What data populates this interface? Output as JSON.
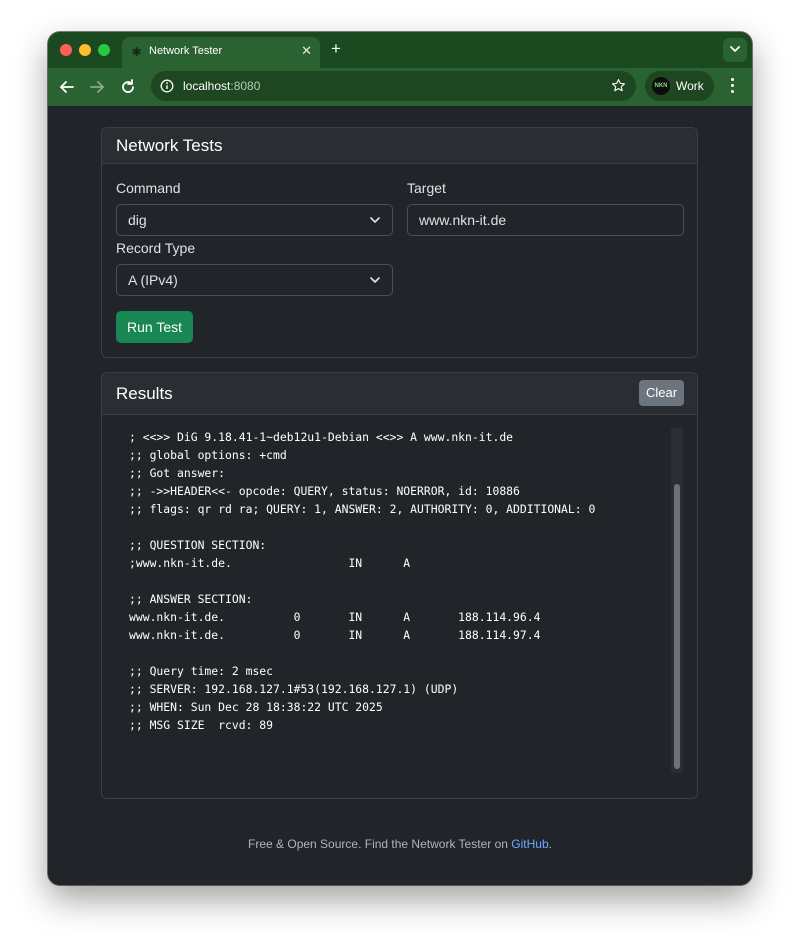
{
  "browser": {
    "tab_title": "Network Tester",
    "url_host": "localhost",
    "url_port": ":8080",
    "profile_label": "Work",
    "profile_avatar_text": "NKN"
  },
  "tests": {
    "title": "Network Tests",
    "command_label": "Command",
    "command_value": "dig",
    "target_label": "Target",
    "target_value": "www.nkn-it.de",
    "record_type_label": "Record Type",
    "record_type_value": "A (IPv4)",
    "run_button": "Run Test"
  },
  "results": {
    "title": "Results",
    "clear_button": "Clear",
    "output": "; <<>> DiG 9.18.41-1~deb12u1-Debian <<>> A www.nkn-it.de\n;; global options: +cmd\n;; Got answer:\n;; ->>HEADER<<- opcode: QUERY, status: NOERROR, id: 10886\n;; flags: qr rd ra; QUERY: 1, ANSWER: 2, AUTHORITY: 0, ADDITIONAL: 0\n\n;; QUESTION SECTION:\n;www.nkn-it.de.                 IN      A\n\n;; ANSWER SECTION:\nwww.nkn-it.de.          0       IN      A       188.114.96.4\nwww.nkn-it.de.          0       IN      A       188.114.97.4\n\n;; Query time: 2 msec\n;; SERVER: 192.168.127.1#53(192.168.127.1) (UDP)\n;; WHEN: Sun Dec 28 18:38:22 UTC 2025\n;; MSG SIZE  rcvd: 89"
  },
  "footer": {
    "text": "Free & Open Source. Find the Network Tester on ",
    "link": "GitHub",
    "end": "."
  },
  "colors": {
    "accent_green": "#198754",
    "browser_frame": "#2b6231",
    "page_background": "#212529",
    "link": "#6ea8fe"
  },
  "icons": [
    "tab-favicon-icon",
    "close-icon",
    "plus-icon",
    "chevron-down-icon",
    "back-icon",
    "forward-icon",
    "reload-icon",
    "info-icon",
    "star-icon",
    "more-icon"
  ]
}
